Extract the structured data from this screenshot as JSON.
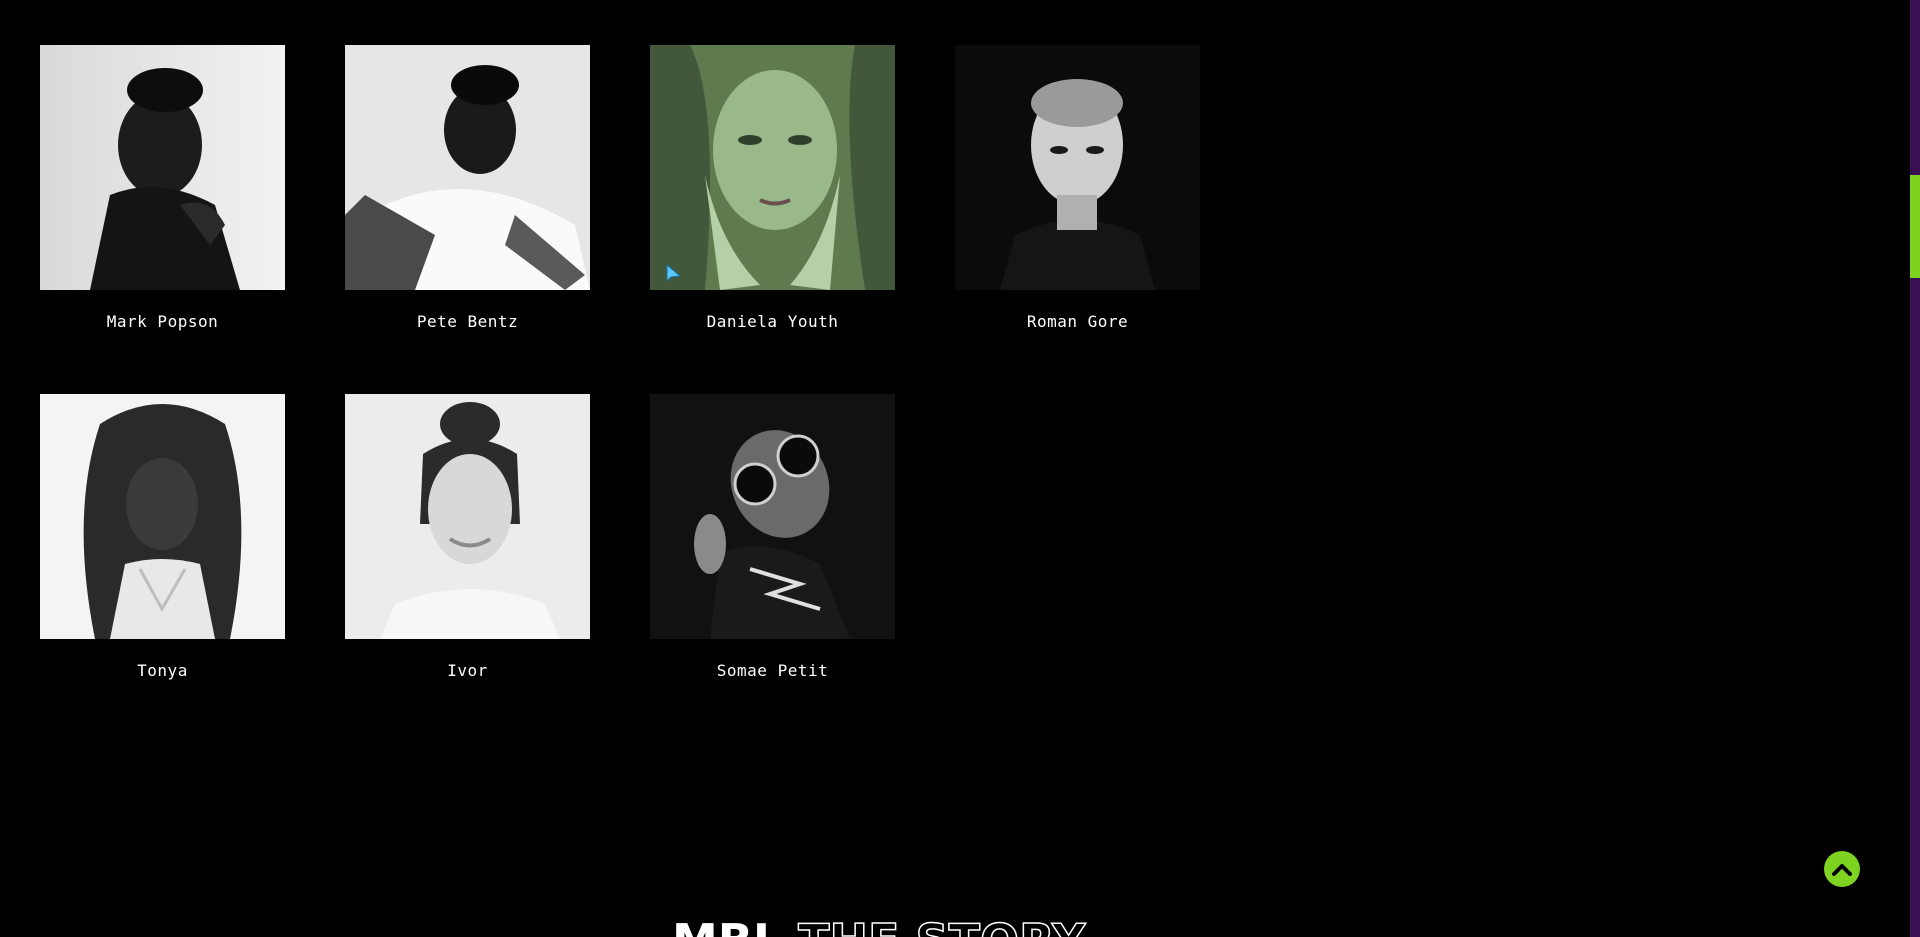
{
  "team": [
    {
      "name": "Mark Popson"
    },
    {
      "name": "Pete Bentz"
    },
    {
      "name": "Daniela Youth"
    },
    {
      "name": "Roman Gore"
    },
    {
      "name": "Tonya"
    },
    {
      "name": "Ivor"
    },
    {
      "name": "Somae Petit"
    }
  ],
  "footer": {
    "heading_solid": "MBL",
    "heading_outline": "THE STORY"
  },
  "icons": {
    "back_to_top": "chevron-up-icon"
  },
  "colors": {
    "background": "#000000",
    "accent": "#7ed321",
    "scrollbar_track": "#3b0f54",
    "hover_tint": "#8fc27a"
  }
}
